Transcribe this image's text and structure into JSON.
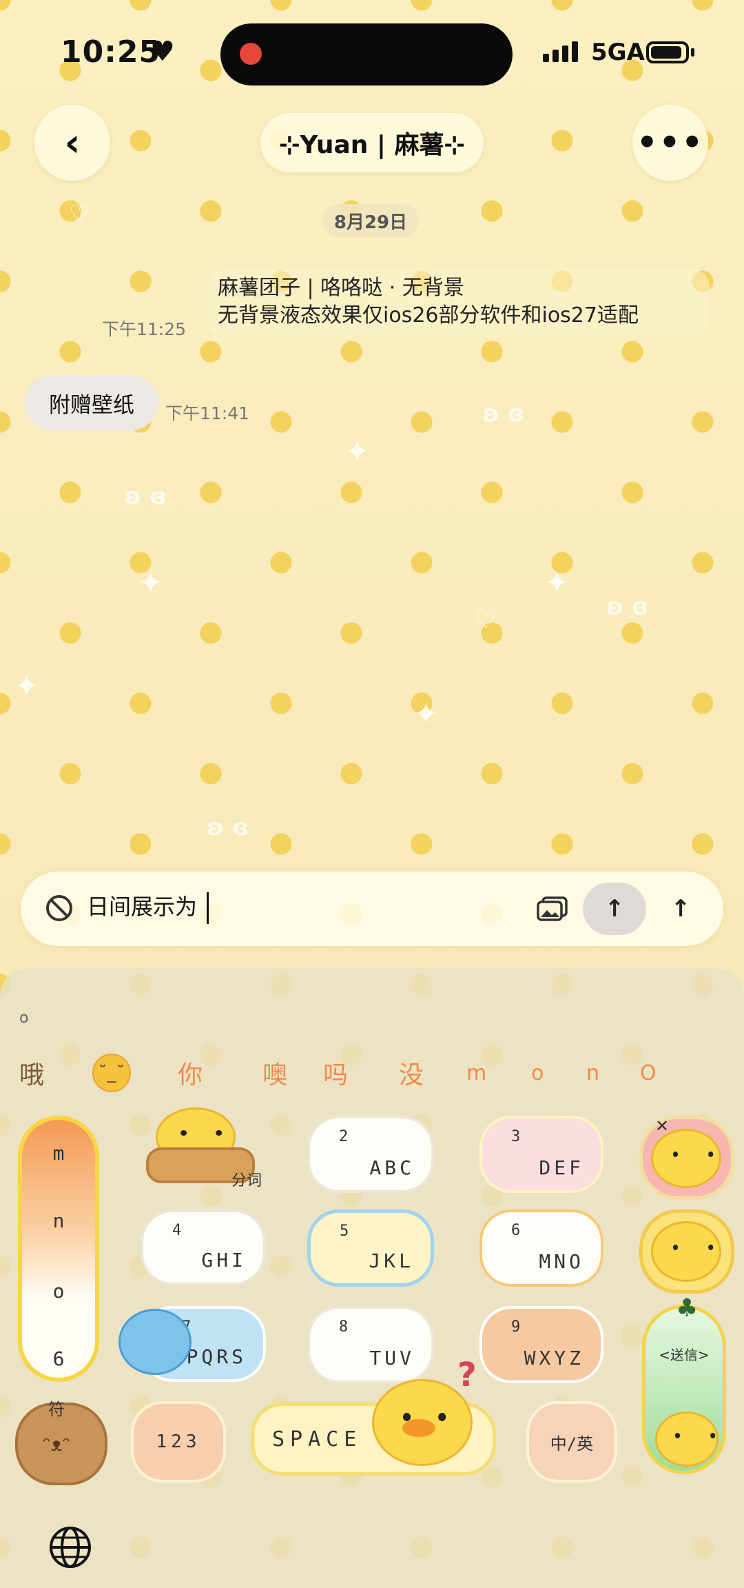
{
  "status": {
    "time": "10:25",
    "network": "5GA"
  },
  "nav": {
    "title": "⊹Yuan | 麻薯⊹"
  },
  "chat": {
    "date": "8月29日",
    "outgoing": {
      "line1": "麻薯团子 | 咯咯哒 · 无背景",
      "line2": "无背景液态效果仅ios26部分软件和ios27适配",
      "time": "下午11:25"
    },
    "incoming": {
      "text": "附赠壁纸",
      "time": "下午11:41"
    }
  },
  "input": {
    "value": "日间展示为"
  },
  "keyboard": {
    "indicator": "o",
    "candidates": [
      "哦",
      "你",
      "噢",
      "吗",
      "没",
      "m",
      "o",
      "n",
      "O"
    ],
    "side_letters": [
      "m",
      "n",
      "o",
      "6"
    ],
    "keys": [
      {
        "num": "2",
        "letters": "ABC"
      },
      {
        "num": "3",
        "letters": "DEF"
      },
      {
        "num": "4",
        "letters": "GHI"
      },
      {
        "num": "5",
        "letters": "JKL"
      },
      {
        "num": "6",
        "letters": "MNO"
      },
      {
        "num": "7",
        "letters": "PQRS"
      },
      {
        "num": "8",
        "letters": "TUV"
      },
      {
        "num": "9",
        "letters": "WXYZ"
      }
    ],
    "tag_cut": "分词",
    "tag_symbols": "符",
    "key_123": "123",
    "key_space": "SPACE",
    "key_lang": "中/英",
    "key_send": "<送信>"
  }
}
